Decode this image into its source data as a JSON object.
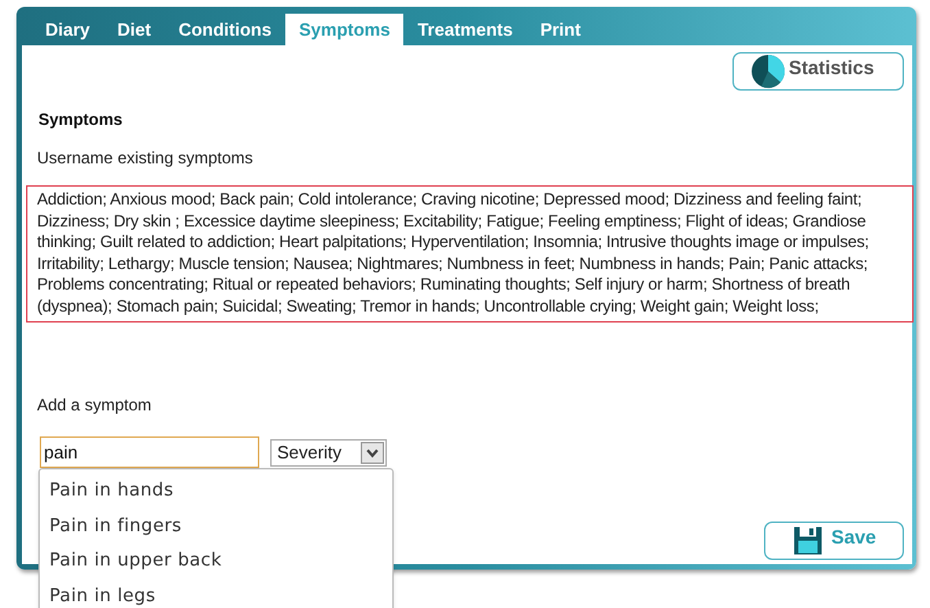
{
  "tabs": [
    {
      "label": "Diary",
      "selected": false
    },
    {
      "label": "Diet",
      "selected": false
    },
    {
      "label": "Conditions",
      "selected": false
    },
    {
      "label": "Symptoms",
      "selected": true
    },
    {
      "label": "Treatments",
      "selected": false
    },
    {
      "label": "Print",
      "selected": false
    }
  ],
  "statistics_button": "Statistics",
  "heading": "Symptoms",
  "existing_label": "Username existing symptoms",
  "existing_symptoms": "Addiction; Anxious mood; Back pain; Cold intolerance; Craving nicotine; Depressed mood; Dizziness and feeling faint; Dizziness; Dry skin ; Excessice daytime sleepiness; Excitability; Fatigue; Feeling emptiness; Flight of ideas; Grandiose thinking; Guilt related to addiction; Heart palpitations; Hyperventilation; Insomnia; Intrusive thoughts image or impulses; Irritability; Lethargy; Muscle tension; Nausea; Nightmares; Numbness in feet; Numbness in hands; Pain; Panic attacks; Problems concentrating; Ritual or repeated behaviors; Ruminating thoughts; Self injury or harm; Shortness of breath (dyspnea); Stomach pain; Suicidal; Sweating; Tremor in hands; Uncontrollable crying; Weight gain; Weight loss;",
  "add_label": "Add a symptom",
  "symptom_field": {
    "value": "pain"
  },
  "severity_select": "Severity",
  "suggestions": [
    "Pain in hands",
    "Pain in fingers",
    "Pain in upper back",
    "Pain in legs"
  ],
  "save_button": "Save"
}
